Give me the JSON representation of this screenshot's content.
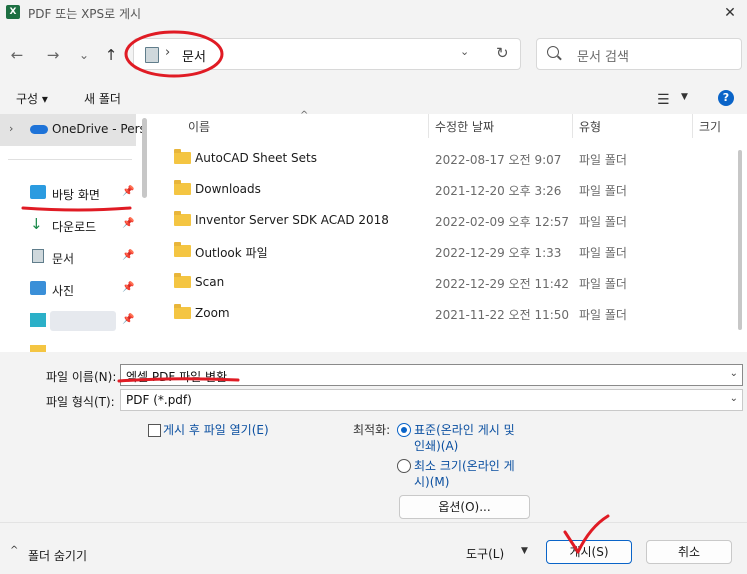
{
  "window": {
    "title": "PDF 또는 XPS로 게시",
    "close": "✕",
    "app_icon": "X"
  },
  "nav": {
    "back": "←",
    "forward": "→",
    "recent": "⌄",
    "up": "↑"
  },
  "address": {
    "separator": "›",
    "location": "문서",
    "dropdown": "⌄",
    "refresh": "↻"
  },
  "search": {
    "placeholder": "문서 검색"
  },
  "toolbar": {
    "organize": "구성 ▾",
    "new_folder": "새 폴더",
    "view": "☰",
    "view_dd": "▼",
    "help": "?"
  },
  "sidebar": {
    "onedrive": "OneDrive - Pers",
    "items": [
      {
        "label": "바탕 화면",
        "icon": "desktop-icon"
      },
      {
        "label": "다운로드",
        "icon": "download-icon"
      },
      {
        "label": "문서",
        "icon": "document-icon"
      },
      {
        "label": "사진",
        "icon": "picture-icon"
      },
      {
        "label": "",
        "icon": "blurred-icon"
      }
    ],
    "pin": "📌"
  },
  "list": {
    "columns": [
      "이름",
      "수정한 날짜",
      "유형",
      "크기"
    ],
    "sort_indicator": "^",
    "rows": [
      {
        "name": "AutoCAD Sheet Sets",
        "date": "2022-08-17 오전 9:07",
        "type": "파일 폴더"
      },
      {
        "name": "Downloads",
        "date": "2021-12-20 오후 3:26",
        "type": "파일 폴더"
      },
      {
        "name": "Inventor Server SDK ACAD 2018",
        "date": "2022-02-09 오후 12:57",
        "type": "파일 폴더"
      },
      {
        "name": "Outlook 파일",
        "date": "2022-12-29 오후 1:33",
        "type": "파일 폴더"
      },
      {
        "name": "Scan",
        "date": "2022-12-29 오전 11:42",
        "type": "파일 폴더"
      },
      {
        "name": "Zoom",
        "date": "2021-11-22 오전 11:50",
        "type": "파일 폴더"
      }
    ]
  },
  "form": {
    "filename_label": "파일 이름(N):",
    "filename_value": "엑셀 PDF 파일 변환",
    "filetype_label": "파일 형식(T):",
    "filetype_value": "PDF (*.pdf)",
    "open_after": "게시 후 파일 열기(E)",
    "optimize_label": "최적화:",
    "opt_standard_1": "표준(온라인 게시 및",
    "opt_standard_2": "인쇄)(A)",
    "opt_min_1": "최소 크기(온라인 게",
    "opt_min_2": "시)(M)",
    "options_button": "옵션(O)..."
  },
  "footer": {
    "hide_folders": "폴더 숨기기",
    "tools": "도구(L)",
    "publish": "게시(S)",
    "cancel": "취소"
  }
}
